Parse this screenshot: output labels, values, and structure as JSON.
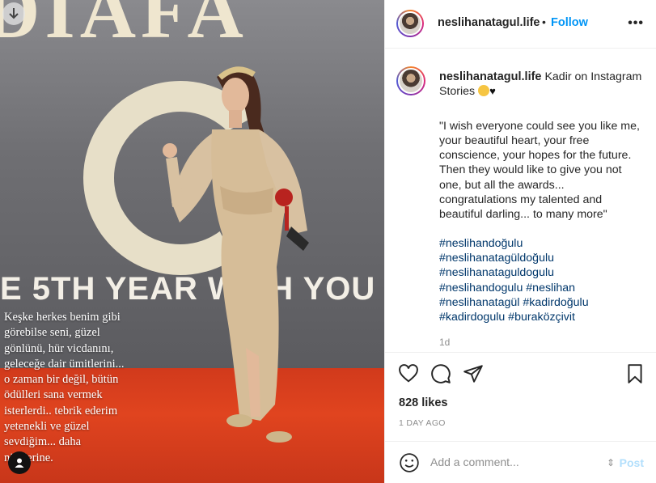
{
  "media": {
    "banner_text": "DIAFA",
    "year_text": "E 5TH YEAR WITH YOU",
    "overlay_lines": [
      "Keşke herkes benim gibi",
      "görebilse seni, güzel",
      "gönlünü, hür vicdanını,",
      "geleceğe dair ümitlerini...",
      "o zaman bir değil, bütün",
      "ödülleri sana vermek",
      "isterlerdi.. tebrik ederim",
      "yetenekli ve güzel",
      "sevdiğim... daha",
      "nicelerine."
    ]
  },
  "header": {
    "username": "neslihanatagul.life",
    "separator": "•",
    "follow_label": "Follow",
    "more_label": "•••"
  },
  "comment": {
    "username": "neslihanatagul.life",
    "lead_text": "Kadir on Instagram",
    "lead_text_2": "Stories",
    "quote_lines": [
      "\"I wish everyone could see you like me,",
      "your beautiful heart, your free",
      "conscience, your hopes for the future.",
      "Then they would like to give you not",
      "one, but all the awards...",
      "congratulations my talented and",
      "beautiful darling... to many more\""
    ],
    "tags": [
      "#neslihandoğulu",
      "#neslihanatagüldoğulu",
      "#neslihanataguldogulu",
      "#neslihandogulu #neslihan",
      "#neslihanatagül #kadirdoğulu",
      "#kadirdogulu #buraközçivit"
    ],
    "age": "1d"
  },
  "stats": {
    "likes": "828 likes",
    "date": "1 DAY AGO"
  },
  "composer": {
    "placeholder": "Add a comment...",
    "post_label": "Post",
    "cursor_glyph": "⇕"
  },
  "colors": {
    "accent": "#0095f6",
    "post_disabled": "#b2dffc",
    "hashtag": "#00376b",
    "muted": "#8e8e8e",
    "carpet": "#d13a1c"
  }
}
